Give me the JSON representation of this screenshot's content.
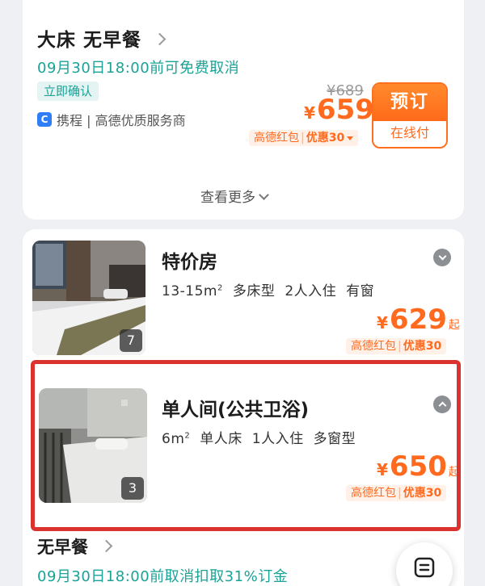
{
  "room_option": {
    "bed_title": "大床 无早餐",
    "cancel_policy": "09月30日18:00前可免费取消",
    "confirm_tag": "立即确认",
    "supplier": "携程 | 高德优质服务商",
    "original_price": "¥689",
    "price_symbol": "¥",
    "price": "659",
    "promo_label": "高德红包",
    "promo_discount": "优惠30",
    "book_label": "预订",
    "pay_label": "在线付"
  },
  "see_more_label": "查看更多",
  "rooms": [
    {
      "name": "特价房",
      "area": "13-15m",
      "area_sup": "2",
      "bed": "多床型",
      "occupancy": "2人入住",
      "window": "有窗",
      "price_symbol": "¥",
      "price": "629",
      "price_suffix": "起",
      "promo_label": "高德红包",
      "promo_discount": "优惠30",
      "photo_count": "7"
    },
    {
      "name": "单人间(公共卫浴)",
      "area": "6m",
      "area_sup": "2",
      "bed": "单人床",
      "occupancy": "1人入住",
      "window": "多窗型",
      "price_symbol": "¥",
      "price": "650",
      "price_suffix": "起",
      "promo_label": "高德红包",
      "promo_discount": "优惠30",
      "photo_count": "3"
    }
  ],
  "bottom_option": {
    "title": "无早餐",
    "cancel_policy": "09月30日18:00前取消扣取31%订金"
  },
  "colors": {
    "accent_orange": "#ff6a1f",
    "teal": "#1aa296",
    "highlight_red": "#d9322f"
  }
}
